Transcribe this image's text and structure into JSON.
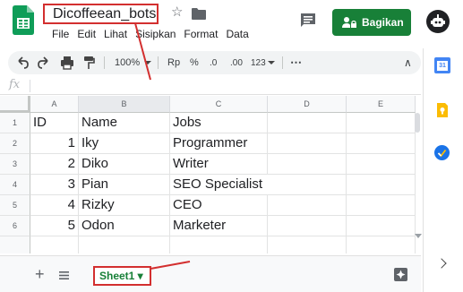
{
  "header": {
    "doc_title": "Dicoffeean_bots",
    "menu": [
      "File",
      "Edit",
      "Lihat",
      "Sisipkan",
      "Format",
      "Data"
    ],
    "share_label": "Bagikan",
    "icons": {
      "logo": "sheets-logo-icon",
      "star": "star-icon",
      "folder": "folder-icon",
      "comment": "comment-icon",
      "share": "lock-person-icon",
      "avatar": "bot-avatar-icon"
    }
  },
  "toolbar": {
    "zoom": "100%",
    "currency": "Rp",
    "percent": "%",
    "dec_decrease": ".0",
    "dec_increase": ".00",
    "number_format": "123",
    "more": "⋯",
    "collapse": "∧"
  },
  "formula_bar": {
    "fx_label": "fx"
  },
  "grid": {
    "columns": [
      "A",
      "B",
      "C",
      "D",
      "E"
    ],
    "rows": [
      "1",
      "2",
      "3",
      "4",
      "5",
      "6"
    ],
    "cells": [
      [
        "ID",
        "Name",
        "Jobs"
      ],
      [
        "1",
        "Iky",
        "Programmer"
      ],
      [
        "2",
        "Diko",
        "Writer"
      ],
      [
        "3",
        "Pian",
        "SEO Specialist"
      ],
      [
        "4",
        "Rizky",
        "CEO"
      ],
      [
        "5",
        "Odon",
        "Marketer"
      ]
    ]
  },
  "bottom": {
    "add_sheet": "+",
    "sheet_tab": "Sheet1 ▾"
  },
  "sidepanel": {
    "icons": [
      "calendar-icon",
      "keep-icon",
      "tasks-icon",
      "expand-panel-icon"
    ],
    "calendar_day": "31"
  },
  "colors": {
    "brand_green": "#188038",
    "annotation_red": "#d32f2f",
    "toolbar_bg": "#f1f3f4"
  }
}
